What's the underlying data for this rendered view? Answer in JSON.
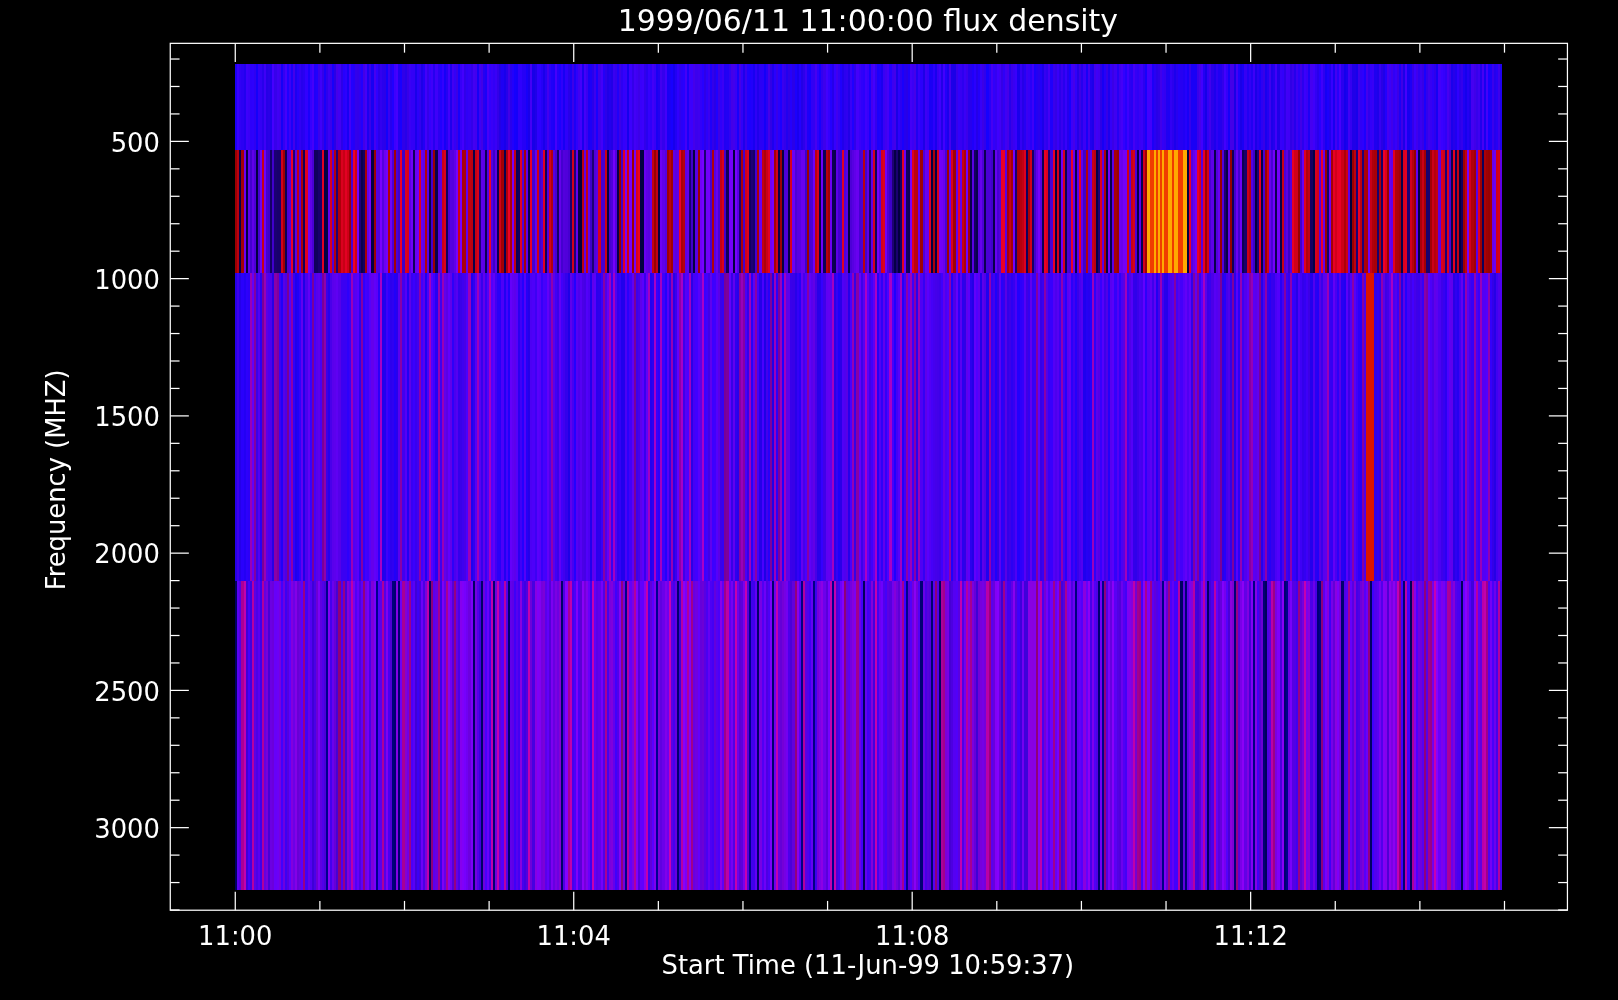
{
  "title": "1999/06/11 11:00:00 flux density",
  "y_axis": {
    "label": "Frequency (MHZ)",
    "ticks": [
      "500",
      "1000",
      "1500",
      "2000",
      "2500",
      "3000"
    ]
  },
  "x_axis": {
    "label": "Start Time (11-Jun-99 10:59:37)",
    "ticks": [
      "11:00",
      "11:04",
      "11:08",
      "11:12"
    ]
  }
}
